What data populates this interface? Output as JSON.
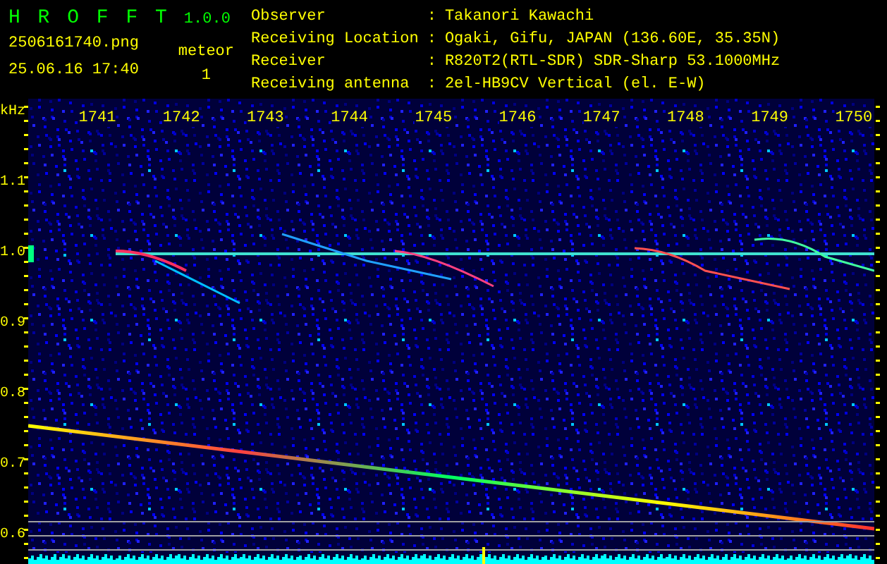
{
  "app": {
    "title": "H R O F F T",
    "version": "1.0.0"
  },
  "capture": {
    "filename": "2506161740.png",
    "datetime": "25.06.16 17:40",
    "event_label": "meteor",
    "event_count": "1"
  },
  "info": [
    {
      "label": "Observer",
      "separator": ":",
      "value": "Takanori Kawachi"
    },
    {
      "label": "Receiving Location",
      "separator": ":",
      "value": "Ogaki, Gifu, JAPAN (136.60E, 35.35N)"
    },
    {
      "label": "Receiver",
      "separator": ":",
      "value": "R820T2(RTL-SDR) SDR-Sharp 53.1000MHz"
    },
    {
      "label": "Receiving antenna",
      "separator": ":",
      "value": "2el-HB9CV Vertical (el. E-W)"
    }
  ],
  "time_axis": {
    "labels": [
      "1741",
      "1742",
      "1743",
      "1744",
      "1745",
      "1746",
      "1747",
      "1748",
      "1749",
      "1750"
    ]
  },
  "frequency_axis": {
    "unit": "kHz",
    "labels": [
      "1.1",
      "1.0",
      "0.9",
      "0.8",
      "0.7",
      "0.6"
    ]
  }
}
